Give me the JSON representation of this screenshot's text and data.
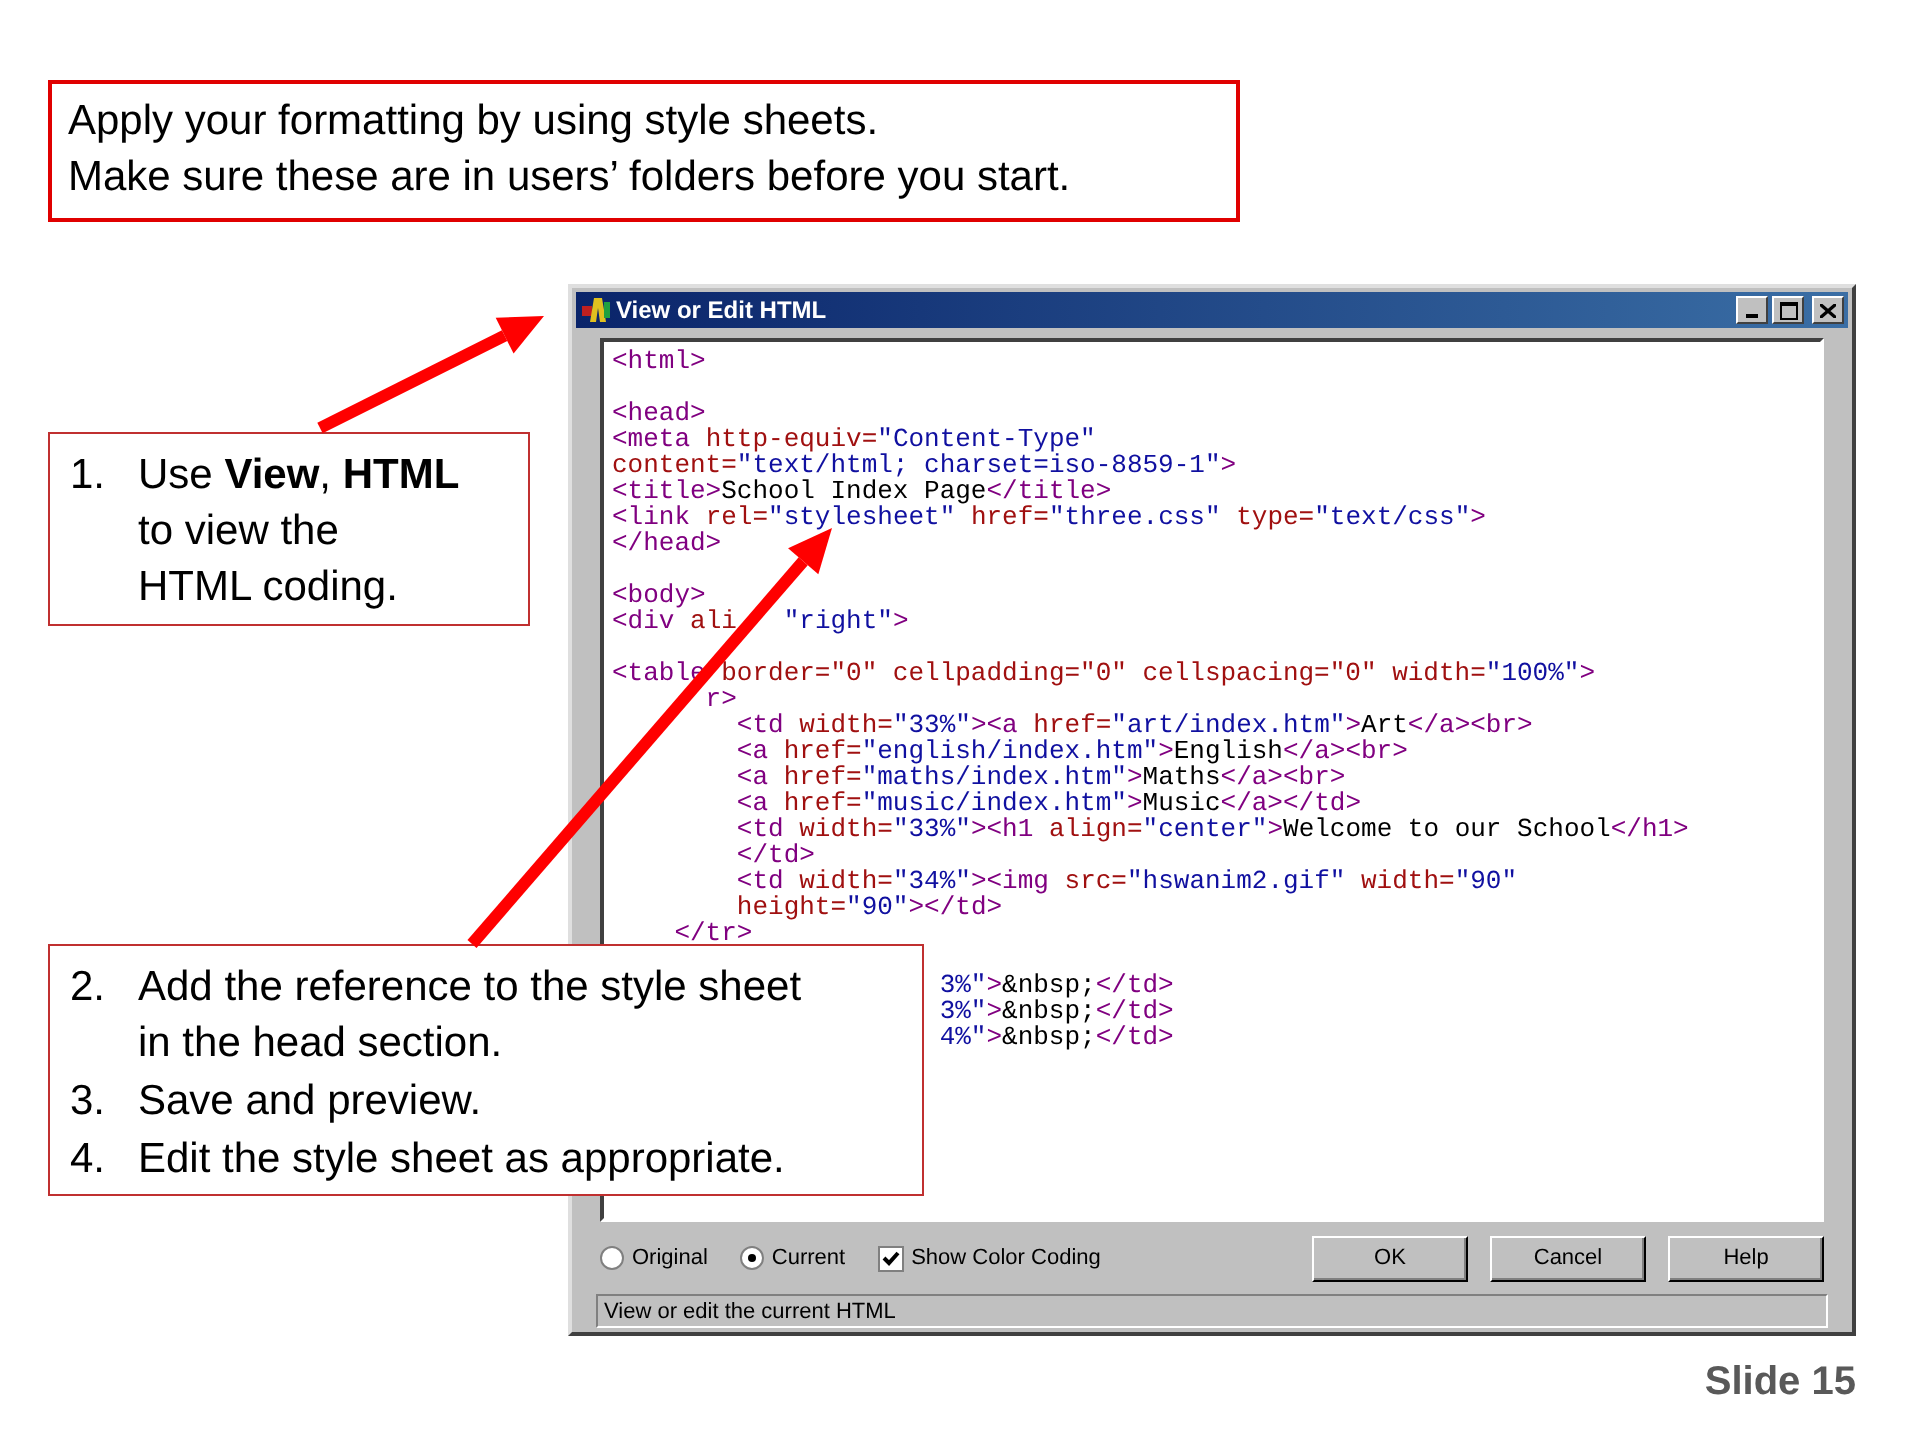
{
  "header_note": {
    "lines": [
      "Apply your formatting by using style sheets.",
      "Make sure these are in users’ folders before you start."
    ]
  },
  "window": {
    "title": "View or Edit HTML",
    "code_lines": [
      {
        "tokens": [
          {
            "kind": "tag",
            "text": "<html>"
          }
        ]
      },
      {
        "blank_before": true,
        "tokens": [
          {
            "kind": "tag",
            "text": "<head>"
          }
        ]
      },
      {
        "tokens": [
          {
            "kind": "tag",
            "text": "<meta"
          },
          {
            "kind": "attr",
            "text": " http-equiv="
          },
          {
            "kind": "value",
            "text": "\"Content-Type\""
          }
        ]
      },
      {
        "tokens": [
          {
            "kind": "attr",
            "text": "content="
          },
          {
            "kind": "value",
            "text": "\"text/html; charset=iso-8859-1\""
          },
          {
            "kind": "tag",
            "text": ">"
          }
        ]
      },
      {
        "tokens": [
          {
            "kind": "tag",
            "text": "<title>"
          },
          {
            "kind": "text",
            "text": "School Index Page"
          },
          {
            "kind": "tag",
            "text": "</title>"
          }
        ]
      },
      {
        "tokens": [
          {
            "kind": "tag",
            "text": "<link"
          },
          {
            "kind": "attr",
            "text": " rel="
          },
          {
            "kind": "value",
            "text": "\"stylesheet\""
          },
          {
            "kind": "attr",
            "text": " href="
          },
          {
            "kind": "value",
            "text": "\"three.css\""
          },
          {
            "kind": "attr",
            "text": " type="
          },
          {
            "kind": "value",
            "text": "\"text/css\""
          },
          {
            "kind": "tag",
            "text": ">"
          }
        ]
      },
      {
        "tokens": [
          {
            "kind": "tag",
            "text": "</head>"
          }
        ]
      },
      {
        "blank_before": true,
        "tokens": [
          {
            "kind": "tag",
            "text": "<body>"
          }
        ]
      },
      {
        "tokens": [
          {
            "kind": "tag",
            "text": "<div"
          },
          {
            "kind": "attr",
            "text": " ali"
          },
          {
            "kind": "value",
            "text": "   \"right\""
          },
          {
            "kind": "tag",
            "text": ">"
          }
        ]
      },
      {
        "blank_before": true,
        "tokens": [
          {
            "kind": "tag",
            "text": "<table"
          },
          {
            "kind": "attr",
            "text": " border=\"0\" cellpadding=\"0\" cellspacing=\"0\" width="
          },
          {
            "kind": "value",
            "text": "\"100%\""
          },
          {
            "kind": "tag",
            "text": ">"
          }
        ]
      },
      {
        "tokens": [
          {
            "kind": "tag",
            "text": "      r>"
          }
        ]
      },
      {
        "tokens": [
          {
            "kind": "tag",
            "text": "        <td"
          },
          {
            "kind": "attr",
            "text": " width="
          },
          {
            "kind": "value",
            "text": "\"33%\""
          },
          {
            "kind": "tag",
            "text": "><a"
          },
          {
            "kind": "attr",
            "text": " href="
          },
          {
            "kind": "value",
            "text": "\"art/index.htm\""
          },
          {
            "kind": "tag",
            "text": ">"
          },
          {
            "kind": "text",
            "text": "Art"
          },
          {
            "kind": "tag",
            "text": "</a><br>"
          }
        ]
      },
      {
        "tokens": [
          {
            "kind": "tag",
            "text": "        <a"
          },
          {
            "kind": "attr",
            "text": " href="
          },
          {
            "kind": "value",
            "text": "\"english/index.htm\""
          },
          {
            "kind": "tag",
            "text": ">"
          },
          {
            "kind": "text",
            "text": "English"
          },
          {
            "kind": "tag",
            "text": "</a><br>"
          }
        ]
      },
      {
        "tokens": [
          {
            "kind": "tag",
            "text": "        <a"
          },
          {
            "kind": "attr",
            "text": " href="
          },
          {
            "kind": "value",
            "text": "\"maths/index.htm\""
          },
          {
            "kind": "tag",
            "text": ">"
          },
          {
            "kind": "text",
            "text": "Maths"
          },
          {
            "kind": "tag",
            "text": "</a><br>"
          }
        ]
      },
      {
        "tokens": [
          {
            "kind": "tag",
            "text": "        <a"
          },
          {
            "kind": "attr",
            "text": " href="
          },
          {
            "kind": "value",
            "text": "\"music/index.htm\""
          },
          {
            "kind": "tag",
            "text": ">"
          },
          {
            "kind": "text",
            "text": "Music"
          },
          {
            "kind": "tag",
            "text": "</a></td>"
          }
        ]
      },
      {
        "tokens": [
          {
            "kind": "tag",
            "text": "        <td"
          },
          {
            "kind": "attr",
            "text": " width="
          },
          {
            "kind": "value",
            "text": "\"33%\""
          },
          {
            "kind": "tag",
            "text": "><h1"
          },
          {
            "kind": "attr",
            "text": " align="
          },
          {
            "kind": "value",
            "text": "\"center\""
          },
          {
            "kind": "tag",
            "text": ">"
          },
          {
            "kind": "text",
            "text": "Welcome to our School"
          },
          {
            "kind": "tag",
            "text": "</h1>"
          }
        ]
      },
      {
        "tokens": [
          {
            "kind": "tag",
            "text": "        </td>"
          }
        ]
      },
      {
        "tokens": [
          {
            "kind": "tag",
            "text": "        <td"
          },
          {
            "kind": "attr",
            "text": " width="
          },
          {
            "kind": "value",
            "text": "\"34%\""
          },
          {
            "kind": "tag",
            "text": "><img"
          },
          {
            "kind": "attr",
            "text": " src="
          },
          {
            "kind": "value",
            "text": "\"hswanim2.gif\""
          },
          {
            "kind": "attr",
            "text": " width="
          },
          {
            "kind": "value",
            "text": "\"90\""
          }
        ]
      },
      {
        "tokens": [
          {
            "kind": "attr",
            "text": "        height="
          },
          {
            "kind": "value",
            "text": "\"90\""
          },
          {
            "kind": "tag",
            "text": "></td>"
          }
        ]
      },
      {
        "tokens": [
          {
            "kind": "tag",
            "text": "    </tr>"
          }
        ]
      },
      {
        "blank_before": true,
        "covered_left": true,
        "tokens": [
          {
            "kind": "value",
            "text": "3%\""
          },
          {
            "kind": "tag",
            "text": ">"
          },
          {
            "kind": "text",
            "text": "&nbsp;"
          },
          {
            "kind": "tag",
            "text": "</td>"
          }
        ]
      },
      {
        "covered_left": true,
        "tokens": [
          {
            "kind": "value",
            "text": "3%\""
          },
          {
            "kind": "tag",
            "text": ">"
          },
          {
            "kind": "text",
            "text": "&nbsp;"
          },
          {
            "kind": "tag",
            "text": "</td>"
          }
        ]
      },
      {
        "covered_left": true,
        "tokens": [
          {
            "kind": "value",
            "text": "4%\""
          },
          {
            "kind": "tag",
            "text": ">"
          },
          {
            "kind": "text",
            "text": "&nbsp;"
          },
          {
            "kind": "tag",
            "text": "</td>"
          }
        ]
      }
    ],
    "view_options": [
      {
        "label": "Original",
        "selected": false
      },
      {
        "label": "Current",
        "selected": true
      }
    ],
    "color_coding": {
      "label": "Show Color Coding",
      "checked": true
    },
    "buttons": [
      "OK",
      "Cancel",
      "Help"
    ],
    "status_bar": "View or edit the current HTML"
  },
  "callouts": [
    {
      "items": [
        {
          "number": "1.",
          "lines": [
            "Use **View**, **HTML**",
            "to view the",
            "HTML coding."
          ]
        }
      ]
    },
    {
      "items": [
        {
          "number": "2.",
          "lines": [
            "Add the reference to the style sheet",
            "in the head section."
          ]
        },
        {
          "number": "3.",
          "lines": [
            "Save and preview."
          ]
        },
        {
          "number": "4.",
          "lines": [
            "Edit the style sheet as appropriate."
          ]
        }
      ]
    }
  ],
  "slide_number": "Slide 15"
}
